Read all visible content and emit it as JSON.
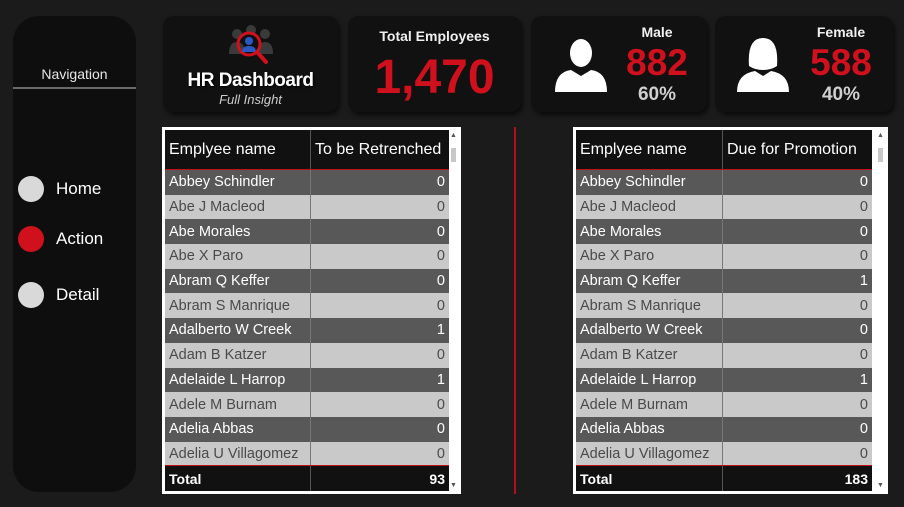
{
  "nav": {
    "title": "Navigation",
    "items": [
      {
        "label": "Home",
        "active": false
      },
      {
        "label": "Action",
        "active": true
      },
      {
        "label": "Detail",
        "active": false
      }
    ]
  },
  "header": {
    "logo_title": "HR Dashboard",
    "logo_subtitle": "Full Insight",
    "total_label": "Total Employees",
    "total_value": "1,470",
    "male_label": "Male",
    "male_value": "882",
    "male_pct": "60%",
    "female_label": "Female",
    "female_value": "588",
    "female_pct": "40%"
  },
  "colors": {
    "accent": "#d0101d",
    "dark_row": "#585858",
    "light_row": "#c9c9c9"
  },
  "retrench_table": {
    "col1": "Emplyee name",
    "col2": "To be Retrenched",
    "rows": [
      [
        "Abbey Schindler",
        "0"
      ],
      [
        "Abe J Macleod",
        "0"
      ],
      [
        "Abe Morales",
        "0"
      ],
      [
        "Abe X Paro",
        "0"
      ],
      [
        "Abram Q Keffer",
        "0"
      ],
      [
        "Abram S Manrique",
        "0"
      ],
      [
        "Adalberto W Creek",
        "1"
      ],
      [
        "Adam B Katzer",
        "0"
      ],
      [
        "Adelaide L Harrop",
        "1"
      ],
      [
        "Adele M Burnam",
        "0"
      ],
      [
        "Adelia Abbas",
        "0"
      ],
      [
        "Adelia U Villagomez",
        "0"
      ]
    ],
    "total_label": "Total",
    "total_value": "93"
  },
  "promotion_table": {
    "col1": "Emplyee name",
    "col2": "Due for Promotion",
    "rows": [
      [
        "Abbey Schindler",
        "0"
      ],
      [
        "Abe J Macleod",
        "0"
      ],
      [
        "Abe Morales",
        "0"
      ],
      [
        "Abe X Paro",
        "0"
      ],
      [
        "Abram Q Keffer",
        "1"
      ],
      [
        "Abram S Manrique",
        "0"
      ],
      [
        "Adalberto W Creek",
        "0"
      ],
      [
        "Adam B Katzer",
        "0"
      ],
      [
        "Adelaide L Harrop",
        "1"
      ],
      [
        "Adele M Burnam",
        "0"
      ],
      [
        "Adelia Abbas",
        "0"
      ],
      [
        "Adelia U Villagomez",
        "0"
      ]
    ],
    "total_label": "Total",
    "total_value": "183"
  },
  "icons": {
    "logo": "people-search-icon",
    "male": "male-person-icon",
    "female": "female-person-icon"
  }
}
